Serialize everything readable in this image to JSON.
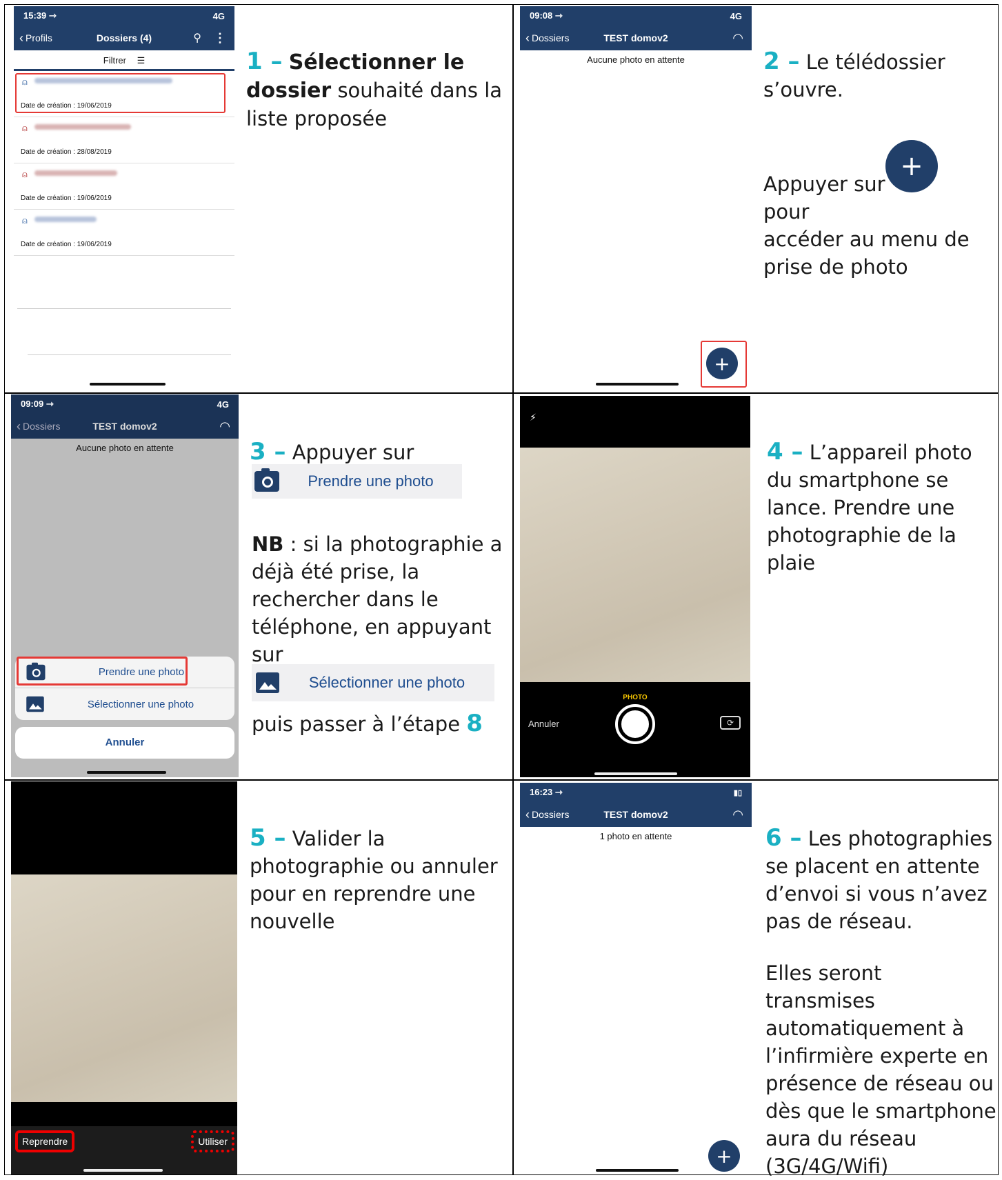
{
  "cell1": {
    "phone": {
      "time": "15:39 ⇾",
      "signal": "4G",
      "back_label": "Profils",
      "title": "Dossiers (4)",
      "filter_label": "Filtrer",
      "items": [
        {
          "date": "Date de création : 19/06/2019"
        },
        {
          "date": "Date de création : 28/08/2019"
        },
        {
          "date": "Date de création : 19/06/2019"
        },
        {
          "date": "Date de création : 19/06/2019"
        }
      ]
    },
    "step_number": "1 –",
    "bold_text": "Sélectionner le dossier",
    "rest_text": " souhaité dans la liste proposée"
  },
  "cell2": {
    "phone": {
      "time": "09:08 ⇾",
      "signal": "4G",
      "back_label": "Dossiers",
      "title": "TEST domov2",
      "subtitle": "Aucune photo en attente"
    },
    "step_number": "2 –",
    "line1": " Le télédossier s’ouvre.",
    "appuyer": "Appuyer sur",
    "pour": "pour",
    "line3": "accéder  au menu de prise de photo"
  },
  "cell3": {
    "phone": {
      "time": "09:09 ⇾",
      "signal": "4G",
      "back_label": "Dossiers",
      "title": "TEST domov2",
      "subtitle": "Aucune photo en attente",
      "take_photo": "Prendre une photo",
      "select_photo": "Sélectionner une photo",
      "cancel": "Annuler"
    },
    "step_number": "3 –",
    "text1": " Appuyer sur",
    "take_photo_btn": "Prendre une photo",
    "nb": "NB",
    "nb_text": " : si la photographie a déjà été prise, la rechercher dans le téléphone, en appuyant sur",
    "select_photo_btn": "Sélectionner une photo",
    "then": "puis passer à l’étape ",
    "step_ref": "8"
  },
  "cell4": {
    "phone": {
      "mode": "PHOTO",
      "cancel": "Annuler"
    },
    "step_number": "4 –",
    "text": " L’appareil photo du smartphone se lance. Prendre une photographie de la plaie"
  },
  "cell5": {
    "phone": {
      "retake": "Reprendre",
      "use": "Utiliser"
    },
    "step_number": "5 –",
    "text": " Valider la photographie ou annuler pour en reprendre une nouvelle"
  },
  "cell6": {
    "phone": {
      "time": "16:23 ⇾",
      "back_label": "Dossiers",
      "title": "TEST domov2",
      "subtitle": "1 photo en attente"
    },
    "step_number": "6 –",
    "text1": " Les photographies se placent en attente d’envoi si vous n’avez pas de réseau.",
    "text2": "Elles seront transmises automatiquement à l’infirmière experte en présence de réseau ou dès que le smartphone aura du réseau (3G/4G/Wifi)"
  },
  "colors": {
    "accent": "#1ab0c3",
    "app_blue": "#213f69",
    "highlight_red": "#e53935"
  }
}
